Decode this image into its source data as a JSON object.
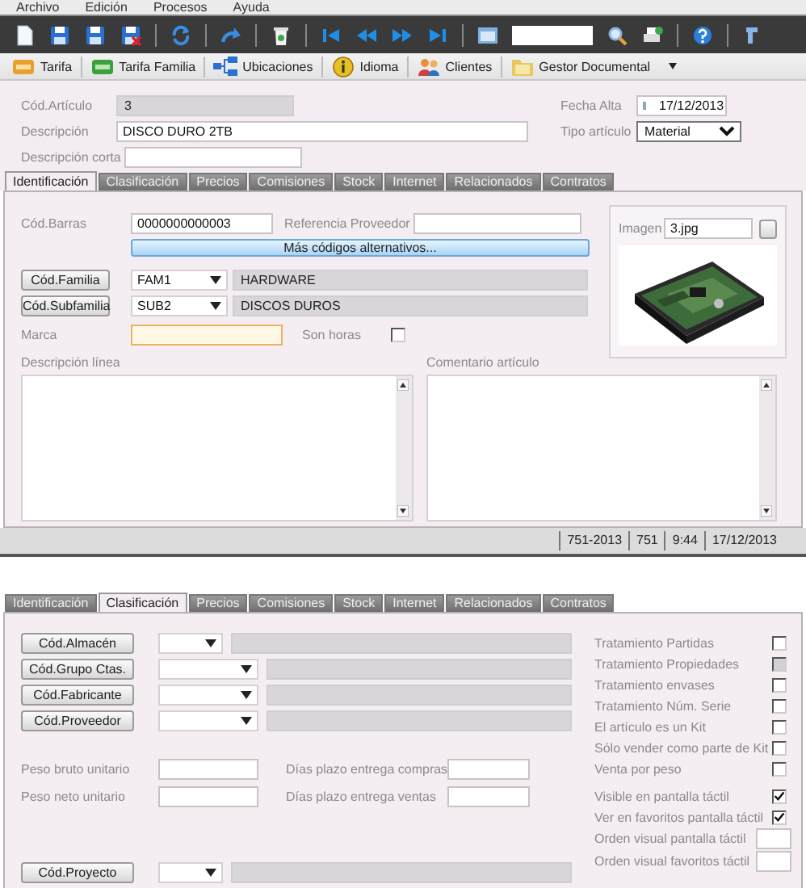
{
  "menu": [
    "Archivo",
    "Edición",
    "Procesos",
    "Ayuda"
  ],
  "shortcuts": [
    {
      "label": "Tarifa",
      "dropdown": false
    },
    {
      "label": "Tarifa Familia",
      "dropdown": false
    },
    {
      "label": "Ubicaciones",
      "dropdown": false
    },
    {
      "label": "Idioma",
      "dropdown": false
    },
    {
      "label": "Clientes",
      "dropdown": false
    },
    {
      "label": "Gestor Documental",
      "dropdown": true
    }
  ],
  "article": {
    "code_label": "Cód.Artículo",
    "code": "3",
    "description_label": "Descripción",
    "description": "DISCO DURO 2TB",
    "short_description_label": "Descripción corta",
    "date_label": "Fecha Alta",
    "date": "17/12/2013",
    "type_label": "Tipo artículo",
    "type": "Material"
  },
  "tabs": [
    {
      "label": "Identificación",
      "selected": true
    },
    {
      "label": "Clasificación",
      "selected": false
    },
    {
      "label": "Precios",
      "selected": false
    },
    {
      "label": "Comisiones",
      "selected": false
    },
    {
      "label": "Stock",
      "selected": false
    },
    {
      "label": "Internet",
      "selected": false
    },
    {
      "label": "Relacionados",
      "selected": false
    },
    {
      "label": "Contratos",
      "selected": false
    }
  ],
  "identificacion": {
    "barcode_label": "Cód.Barras",
    "barcode": "0000000000003",
    "supplier_ref_label": "Referencia Proveedor",
    "alt_codes_button": "Más códigos alternativos...",
    "lookups": [
      {
        "button": "Cód.Familia",
        "code": "FAM1",
        "name": "HARDWARE"
      },
      {
        "button": "Cód.Subfamilia",
        "code": "SUB2",
        "name": "DISCOS DUROS"
      }
    ],
    "brand_label": "Marca",
    "hours_label": "Son horas",
    "hours_checked": false,
    "image_label": "Imagen",
    "image_file": "3.jpg",
    "line_description_label": "Descripción línea",
    "comment_label": "Comentario artículo"
  },
  "status_bar": [
    "751-2013",
    "751",
    "9:44",
    "17/12/2013"
  ],
  "second_view": {
    "tabs": [
      {
        "label": "Identificación",
        "selected": false
      },
      {
        "label": "Clasificación",
        "selected": true
      },
      {
        "label": "Precios",
        "selected": false
      },
      {
        "label": "Comisiones",
        "selected": false
      },
      {
        "label": "Stock",
        "selected": false
      },
      {
        "label": "Internet",
        "selected": false
      },
      {
        "label": "Relacionados",
        "selected": false
      },
      {
        "label": "Contratos",
        "selected": false
      }
    ],
    "lookups": [
      {
        "button": "Cód.Almacén",
        "kind": "short"
      },
      {
        "button": "Cód.Grupo Ctas.",
        "kind": "wide"
      },
      {
        "button": "Cód.Fabricante",
        "kind": "wide"
      },
      {
        "button": "Cód.Proveedor",
        "kind": "wide"
      }
    ],
    "weights": [
      {
        "label": "Peso bruto unitario",
        "days_label": "Días plazo entrega compras"
      },
      {
        "label": "Peso neto unitario",
        "days_label": "Días plazo entrega ventas"
      }
    ],
    "project_lookup": {
      "button": "Cód.Proyecto",
      "kind": "short"
    },
    "options": [
      {
        "label": "Tratamiento Partidas",
        "kind": "check",
        "checked": false,
        "disabled": false
      },
      {
        "label": "Tratamiento Propiedades",
        "kind": "check",
        "checked": false,
        "disabled": true
      },
      {
        "label": "Tratamiento envases",
        "kind": "check",
        "checked": false,
        "disabled": false
      },
      {
        "label": "Tratamiento Núm. Serie",
        "kind": "check",
        "checked": false,
        "disabled": false
      },
      {
        "label": "El artículo es un Kit",
        "kind": "check",
        "checked": false,
        "disabled": false
      },
      {
        "label": "Sólo vender como parte de Kit",
        "kind": "check",
        "checked": false,
        "disabled": false
      },
      {
        "label": "Venta por peso",
        "kind": "check",
        "checked": false,
        "disabled": false
      },
      {
        "label": "Visible en pantalla táctil",
        "kind": "check",
        "checked": true,
        "disabled": false
      },
      {
        "label": "Ver en favoritos pantalla táctil",
        "kind": "check",
        "checked": true,
        "disabled": false
      },
      {
        "label": "Orden visual pantalla táctil",
        "kind": "number"
      },
      {
        "label": "Orden visual favoritos táctil",
        "kind": "number"
      }
    ]
  }
}
